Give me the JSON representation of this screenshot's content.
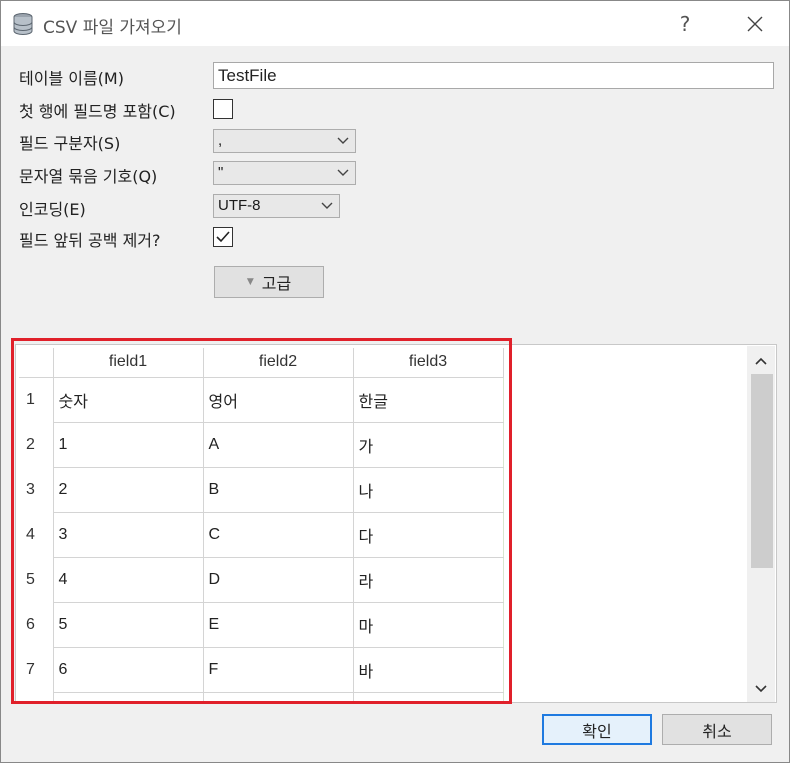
{
  "window": {
    "title": "CSV 파일 가져오기",
    "help": "?",
    "close": "✕"
  },
  "form": {
    "table_name_label": "테이블 이름(M)",
    "table_name_value": "TestFile",
    "header_label": "첫 행에 필드명 포함(C)",
    "header_checked": false,
    "separator_label": "필드 구분자(S)",
    "separator_value": ",",
    "quote_label": "문자열 묶음 기호(Q)",
    "quote_value": "\"",
    "encoding_label": "인코딩(E)",
    "encoding_value": "UTF-8",
    "trim_label": "필드 앞뒤 공백 제거?",
    "trim_checked": true,
    "advanced_label": "고급"
  },
  "preview": {
    "columns": [
      "field1",
      "field2",
      "field3"
    ],
    "rows": [
      {
        "n": "1",
        "cells": [
          "숫자",
          "영어",
          "한글"
        ]
      },
      {
        "n": "2",
        "cells": [
          "1",
          "A",
          "가"
        ]
      },
      {
        "n": "3",
        "cells": [
          "2",
          "B",
          "나"
        ]
      },
      {
        "n": "4",
        "cells": [
          "3",
          "C",
          "다"
        ]
      },
      {
        "n": "5",
        "cells": [
          "4",
          "D",
          "라"
        ]
      },
      {
        "n": "6",
        "cells": [
          "5",
          "E",
          "마"
        ]
      },
      {
        "n": "7",
        "cells": [
          "6",
          "F",
          "바"
        ]
      }
    ]
  },
  "footer": {
    "ok": "확인",
    "cancel": "취소"
  },
  "colors": {
    "highlight": "#e0202a",
    "accent": "#1f7ae0"
  }
}
